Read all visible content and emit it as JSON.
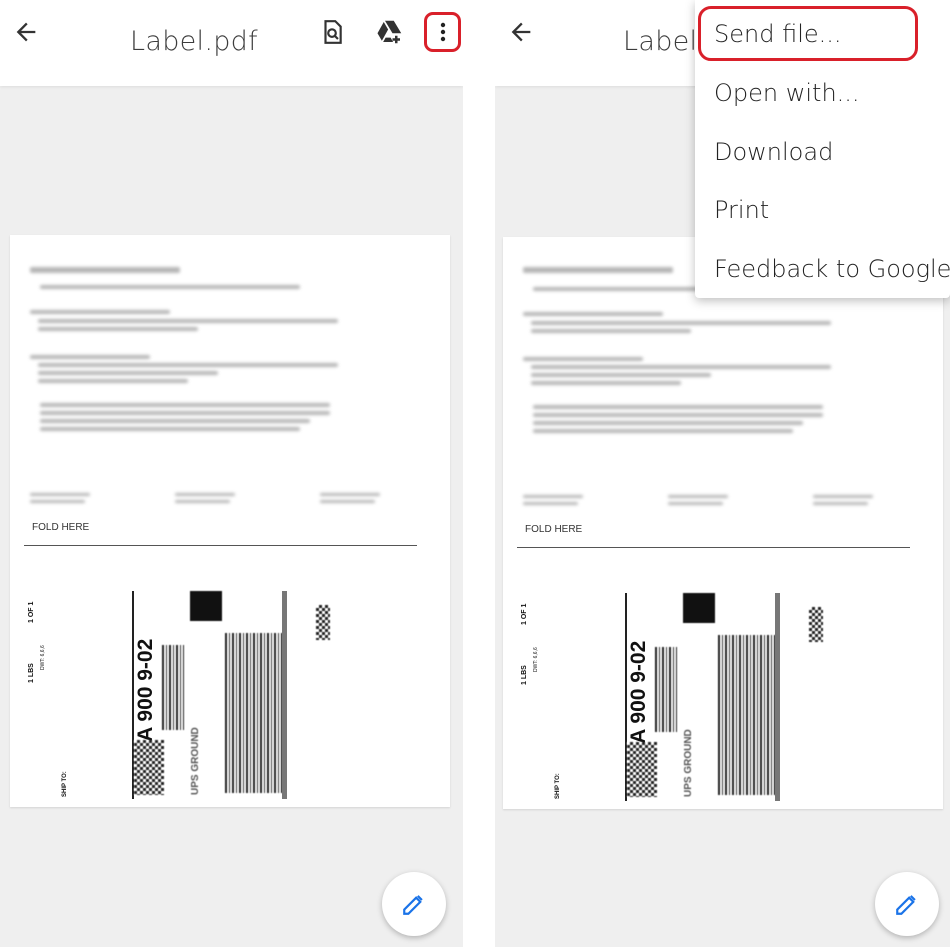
{
  "left_panel": {
    "title": "Label.pdf",
    "icons": [
      "back-arrow-icon",
      "search-in-document-icon",
      "add-to-drive-icon",
      "more-options-icon"
    ]
  },
  "right_panel": {
    "title": "Label.",
    "menu": {
      "items": [
        {
          "label": "Send file..."
        },
        {
          "label": "Open with..."
        },
        {
          "label": "Download"
        },
        {
          "label": "Print"
        },
        {
          "label": "Feedback to Google"
        }
      ]
    }
  },
  "document": {
    "fold_label": "FOLD HERE",
    "shipping_label": {
      "count": "1 OF 1",
      "weight": "1 LBS",
      "dwt": "DWT: 6,6,6",
      "ship_to": "SHIP TO:",
      "route_code": "CA 900 9-02",
      "service": "UPS GROUND"
    }
  },
  "accent_colors": {
    "highlight": "#d9202a",
    "pencil": "#1a73e8"
  }
}
